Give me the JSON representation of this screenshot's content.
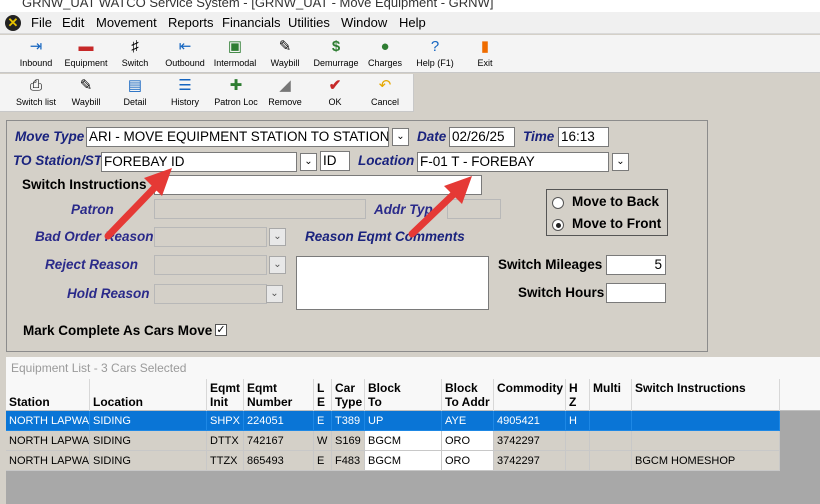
{
  "window": {
    "title": "GRNW_UAT WATCO Service System - [GRNW_UAT - Move Equipment - GRNW]"
  },
  "menu": [
    "File",
    "Edit",
    "Movement",
    "Reports",
    "Financials",
    "Utilities",
    "Window",
    "Help"
  ],
  "toolbar1": [
    "Inbound",
    "Equipment",
    "Switch",
    "Outbound",
    "Intermodal",
    "Waybill",
    "Demurrage",
    "Charges",
    "Help (F1)",
    "Exit"
  ],
  "toolbar2": [
    "Switch list",
    "Waybill",
    "Detail",
    "History",
    "Patron Loc",
    "Remove",
    "OK",
    "Cancel"
  ],
  "form": {
    "move_type_label": "Move Type",
    "move_type_value": "ARI - MOVE EQUIPMENT STATION TO STATION (W",
    "date_label": "Date",
    "date_value": "02/26/25",
    "time_label": "Time",
    "time_value": "16:13",
    "to_station_label": "TO Station/ST",
    "to_station_value": "FOREBAY ID",
    "state_value": "ID",
    "location_label": "Location",
    "location_value": "F-01 T - FOREBAY",
    "switch_instructions_label": "Switch Instructions",
    "switch_instructions_value": "",
    "patron_label": "Patron",
    "addr_label": "Addr Typ",
    "bad_order_label": "Bad Order Reason",
    "reason_comments_label": "Reason Eqmt Comments",
    "reject_label": "Reject Reason",
    "hold_label": "Hold Reason",
    "switch_mileages_label": "Switch Mileages",
    "switch_mileages_value": "5",
    "switch_hours_label": "Switch Hours",
    "switch_hours_value": "",
    "move_to_back": "Move to Back",
    "move_to_front": "Move to Front",
    "mark_complete_label": "Mark Complete As Cars Move",
    "mark_complete_checked": true,
    "selected_move": "front"
  },
  "grid": {
    "title": "Equipment List - 3 Cars Selected",
    "headers": [
      [
        "",
        "Station"
      ],
      [
        "",
        "Location"
      ],
      [
        "Eqmt",
        "Init"
      ],
      [
        "Eqmt",
        "Number"
      ],
      [
        "L",
        "E"
      ],
      [
        "Car",
        "Type"
      ],
      [
        "Block",
        "To"
      ],
      [
        "Block",
        "To Addr"
      ],
      [
        "Commodity",
        ""
      ],
      [
        "H",
        "Z"
      ],
      [
        "Multi",
        ""
      ],
      [
        "Switch Instructions",
        ""
      ]
    ],
    "rows": [
      [
        "NORTH LAPWAI",
        "SIDING",
        "SHPX",
        "224051",
        "E",
        "T389",
        "UP",
        "AYE",
        "4905421",
        "H",
        "",
        ""
      ],
      [
        "NORTH LAPWAI",
        "SIDING",
        "DTTX",
        "742167",
        "W",
        "S169",
        "BGCM",
        "ORO",
        "3742297",
        "",
        "",
        ""
      ],
      [
        "NORTH LAPWAI",
        "SIDING",
        "TTZX",
        "865493",
        "E",
        "F483",
        "BGCM",
        "ORO",
        "3742297",
        "",
        "",
        "BGCM HOMESHOP"
      ]
    ]
  }
}
